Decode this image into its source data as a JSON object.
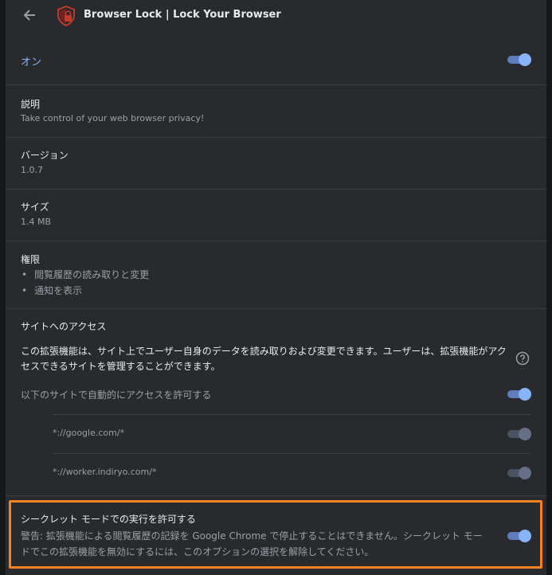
{
  "header": {
    "title": "Browser Lock | Lock Your Browser",
    "back_icon": "arrow-left-icon",
    "logo_icon": "shield-lock-logo"
  },
  "enabled": {
    "label": "オン",
    "state": true
  },
  "description": {
    "label": "説明",
    "value": "Take control of your web browser privacy!"
  },
  "version": {
    "label": "バージョン",
    "value": "1.0.7"
  },
  "size": {
    "label": "サイズ",
    "value": "1.4 MB"
  },
  "permissions": {
    "label": "権限",
    "items": [
      "閲覧履歴の読み取りと変更",
      "通知を表示"
    ]
  },
  "site_access": {
    "label": "サイトへのアクセス",
    "description": "この拡張機能は、サイト上でユーザー自身のデータを読み取りおよび変更できます。ユーザーは、拡張機能がアクセスできるサイトを管理することができます。",
    "auto_allow_label": "以下のサイトで自動的にアクセスを許可する",
    "auto_allow_state": true,
    "sites": [
      {
        "pattern": "*://google.com/*",
        "state": true
      },
      {
        "pattern": "*://worker.indiryo.com/*",
        "state": true
      }
    ]
  },
  "incognito": {
    "label": "シークレット モードでの実行を許可する",
    "warning": "警告: 拡張機能による閲覧履歴の記録を Google Chrome で停止することはできません。シークレット モードでこの拡張機能を無効にするには、このオプションの選択を解除してください。",
    "state": true
  },
  "colors": {
    "accent": "#8ab4f8",
    "highlight": "#f5821f",
    "background": "#292a2d"
  }
}
